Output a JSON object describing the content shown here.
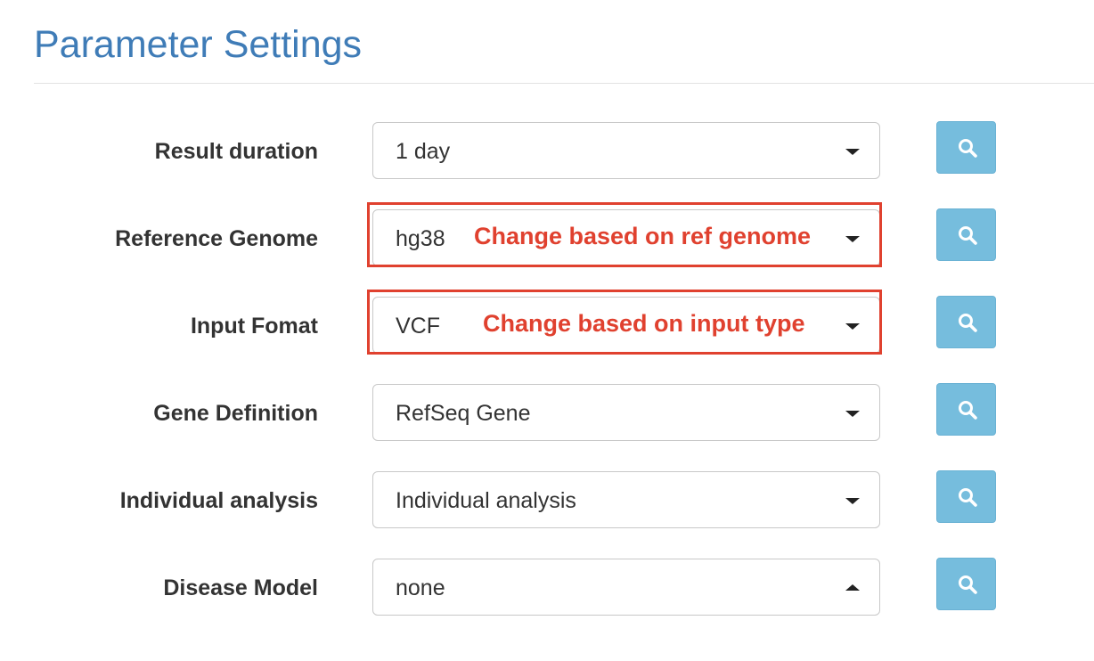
{
  "page": {
    "title": "Parameter Settings"
  },
  "rows": [
    {
      "label": "Result duration",
      "value": "1 day",
      "caret": "chevron-down"
    },
    {
      "label": "Reference Genome",
      "value": "hg38",
      "caret": "chevron-down",
      "annotation": "Change based on ref genome"
    },
    {
      "label": "Input Fomat",
      "value": "VCF",
      "caret": "chevron-down",
      "annotation": "Change based on input type"
    },
    {
      "label": "Gene Definition",
      "value": "RefSeq Gene",
      "caret": "chevron-down"
    },
    {
      "label": "Individual analysis",
      "value": "Individual analysis",
      "caret": "chevron-down"
    },
    {
      "label": "Disease Model",
      "value": "none",
      "caret": "chevron-up"
    }
  ],
  "icons": {
    "search_button": "search-icon"
  },
  "colors": {
    "title": "#3f7cb7",
    "button": "#76bddd",
    "annotation": "#e0412f",
    "label_text": "#333333"
  }
}
